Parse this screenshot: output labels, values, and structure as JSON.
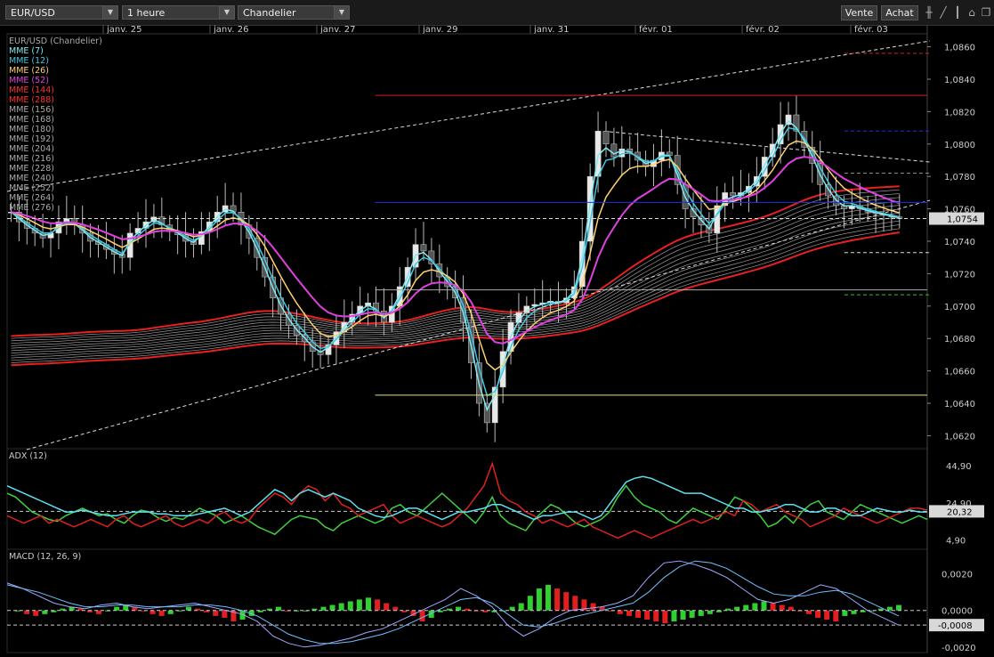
{
  "toolbar": {
    "instrument": "EUR/USD",
    "interval": "1 heure",
    "chart_style": "Chandelier",
    "sell_label": "Vente",
    "buy_label": "Achat",
    "icons": [
      "bar-chart-icon",
      "draw-line-icon",
      "candlestick-icon",
      "home-icon",
      "window-icon"
    ]
  },
  "colors": {
    "background": "#000000",
    "up": "#ffffff",
    "ema7": "#80e8f0",
    "ema12": "#40c8e0",
    "ema26": "#ffd070",
    "ema52": "#e040e0",
    "ema144": "#e82020",
    "ema288": "#d01010",
    "ribbon": "#9a9a9a",
    "adx_plus": "#40d040",
    "adx_minus": "#e02020",
    "adx": "#60e0f0",
    "macd_line": "#a0a8ff",
    "macd_signal": "#70c0ff"
  },
  "chart_data": [
    {
      "type": "candlestick",
      "title": "EUR/USD (Chandelier)",
      "x_ticks": [
        "janv. 25",
        "janv. 26",
        "janv. 27",
        "janv. 29",
        "janv. 31",
        "févr. 01",
        "févr. 02",
        "févr. 03"
      ],
      "y_ticks": [
        "1,0860",
        "1,0840",
        "1,0820",
        "1,0800",
        "1,0780",
        "1,0760",
        "1,0740",
        "1,0720",
        "1,0700",
        "1,0680",
        "1,0660",
        "1,0640",
        "1,0620"
      ],
      "ylim": [
        1.0612,
        1.0868
      ],
      "last_price": "1,0754",
      "legend": [
        "MME (7)",
        "MME (12)",
        "MME (26)",
        "MME (52)",
        "MME (144)",
        "MME (288)",
        "MME (156)",
        "MME (168)",
        "MME (180)",
        "MME (192)",
        "MME (204)",
        "MME (216)",
        "MME (228)",
        "MME (240)",
        "MME (252)",
        "MME (264)",
        "MME (276)"
      ],
      "legend_colors": [
        "#80e8f0",
        "#40c8e0",
        "#ffd070",
        "#e040e0",
        "#ff3030",
        "#ff3030",
        "#aaaaaa",
        "#aaaaaa",
        "#aaaaaa",
        "#aaaaaa",
        "#aaaaaa",
        "#aaaaaa",
        "#aaaaaa",
        "#aaaaaa",
        "#aaaaaa",
        "#aaaaaa",
        "#aaaaaa"
      ],
      "close_path": [
        1.0758,
        1.0752,
        1.0748,
        1.0745,
        1.0742,
        1.0745,
        1.0752,
        1.0754,
        1.075,
        1.0745,
        1.074,
        1.0738,
        1.0735,
        1.0732,
        1.073,
        1.0745,
        1.0748,
        1.0752,
        1.0755,
        1.075,
        1.0746,
        1.0744,
        1.074,
        1.0738,
        1.0746,
        1.0752,
        1.0758,
        1.0762,
        1.0758,
        1.075,
        1.0742,
        1.073,
        1.0718,
        1.0705,
        1.0695,
        1.0688,
        1.0682,
        1.0678,
        1.0672,
        1.067,
        1.0676,
        1.0684,
        1.069,
        1.0695,
        1.07,
        1.0702,
        1.0697,
        1.069,
        1.07,
        1.0712,
        1.0724,
        1.0738,
        1.0734,
        1.0726,
        1.0718,
        1.0712,
        1.0705,
        1.069,
        1.0665,
        1.064,
        1.0628,
        1.065,
        1.0672,
        1.069,
        1.0696,
        1.07,
        1.0701,
        1.0702,
        1.0703,
        1.0702,
        1.0705,
        1.0712,
        1.074,
        1.078,
        1.0808,
        1.08,
        1.0792,
        1.0797,
        1.0795,
        1.079,
        1.0786,
        1.079,
        1.0795,
        1.0793,
        1.0775,
        1.076,
        1.0755,
        1.075,
        1.0745,
        1.0762,
        1.077,
        1.0768,
        1.077,
        1.0774,
        1.078,
        1.0792,
        1.08,
        1.0812,
        1.0818,
        1.0808,
        1.0798,
        1.0788,
        1.0775,
        1.0768,
        1.0762,
        1.076,
        1.0762,
        1.076,
        1.0758,
        1.0757,
        1.0756,
        1.0755,
        1.0754
      ],
      "hlines": [
        {
          "value": 1.083,
          "color": "#d02020",
          "start": 0.4,
          "style": "solid"
        },
        {
          "value": 1.0764,
          "color": "#2030e0",
          "start": 0.4,
          "style": "solid"
        },
        {
          "value": 1.071,
          "color": "#aaaaaa",
          "start": 0.4,
          "style": "solid"
        },
        {
          "value": 1.0645,
          "color": "#e8e070",
          "start": 0.4,
          "style": "solid"
        },
        {
          "value": 1.0754,
          "color": "#dddddd",
          "start": 0.0,
          "style": "dashed"
        },
        {
          "value": 1.0856,
          "color": "#d02020",
          "start": 0.91,
          "style": "dashed"
        },
        {
          "value": 1.0808,
          "color": "#2030e0",
          "start": 0.91,
          "style": "dashed"
        },
        {
          "value": 1.0782,
          "color": "#888888",
          "start": 0.91,
          "style": "dashed"
        },
        {
          "value": 1.0733,
          "color": "#dddddd",
          "start": 0.91,
          "style": "dashed"
        },
        {
          "value": 1.0707,
          "color": "#30c030",
          "start": 0.91,
          "style": "dashed"
        }
      ]
    },
    {
      "type": "line",
      "title": "ADX (12)",
      "y_ticks": [
        "44,90",
        "24,90",
        "4,90"
      ],
      "ylim": [
        0,
        52
      ],
      "last_value": "20,32",
      "series": [
        {
          "name": "",
          "values": [
            30,
            28,
            24,
            20,
            18,
            16,
            15,
            18,
            20,
            22,
            20,
            18,
            19,
            16,
            14,
            18,
            21,
            20,
            17,
            15,
            17,
            16,
            19,
            22,
            20,
            18,
            14,
            16,
            18,
            15,
            12,
            10,
            8,
            12,
            16,
            18,
            17,
            16,
            12,
            10,
            14,
            16,
            18,
            16,
            14,
            16,
            22,
            24,
            20,
            18,
            22,
            26,
            30,
            26,
            22,
            18,
            14,
            20,
            28,
            18,
            14,
            12,
            10,
            16,
            20,
            24,
            22,
            18,
            14,
            12,
            14,
            16,
            20,
            28,
            34,
            28,
            24,
            22,
            20,
            16,
            14,
            18,
            22,
            20,
            18,
            16,
            22,
            28,
            26,
            22,
            18,
            12,
            14,
            18,
            14,
            20,
            24,
            26,
            20,
            18,
            16,
            20,
            24,
            22,
            20,
            18,
            16,
            14,
            16,
            18,
            16
          ]
        },
        {
          "name": "",
          "values": [
            18,
            16,
            14,
            16,
            18,
            14,
            16,
            14,
            12,
            14,
            16,
            14,
            12,
            16,
            18,
            14,
            12,
            14,
            16,
            18,
            14,
            12,
            14,
            16,
            14,
            18,
            20,
            16,
            14,
            16,
            22,
            26,
            30,
            28,
            24,
            30,
            34,
            32,
            26,
            30,
            24,
            22,
            18,
            20,
            22,
            24,
            18,
            14,
            16,
            18,
            16,
            14,
            12,
            14,
            18,
            22,
            28,
            34,
            46,
            30,
            26,
            24,
            20,
            18,
            14,
            16,
            14,
            12,
            14,
            16,
            12,
            10,
            8,
            6,
            8,
            10,
            8,
            6,
            8,
            10,
            12,
            14,
            16,
            14,
            16,
            18,
            20,
            18,
            26,
            24,
            20,
            22,
            24,
            20,
            18,
            16,
            12,
            14,
            16,
            18,
            22,
            20,
            18,
            16,
            14,
            16,
            18,
            20,
            22,
            22,
            21
          ]
        },
        {
          "name": "",
          "values": [
            34,
            32,
            30,
            28,
            26,
            24,
            22,
            20,
            20,
            21,
            20,
            19,
            18,
            18,
            19,
            20,
            20,
            20,
            19,
            19,
            18,
            18,
            18,
            19,
            20,
            21,
            22,
            20,
            18,
            20,
            24,
            28,
            32,
            30,
            26,
            30,
            32,
            30,
            28,
            30,
            28,
            26,
            22,
            20,
            18,
            17,
            18,
            20,
            22,
            22,
            20,
            18,
            16,
            18,
            20,
            20,
            21,
            22,
            24,
            24,
            22,
            20,
            18,
            16,
            18,
            18,
            19,
            20,
            20,
            18,
            16,
            18,
            24,
            30,
            36,
            38,
            39,
            38,
            36,
            34,
            32,
            30,
            30,
            30,
            28,
            26,
            24,
            22,
            22,
            20,
            20,
            21,
            22,
            24,
            24,
            22,
            20,
            20,
            22,
            22,
            20,
            18,
            18,
            20,
            22,
            21,
            20,
            20,
            21,
            20,
            20
          ]
        }
      ]
    },
    {
      "type": "bar",
      "title": "MACD (12, 26, 9)",
      "y_ticks": [
        "0,0020",
        "0,0000",
        "-0,0020"
      ],
      "ylim": [
        -0.0023,
        0.0031
      ],
      "last_value": "-0,0008",
      "histogram": [
        0.0,
        -0.0002,
        -0.0003,
        -0.0002,
        -0.0001,
        0.0001,
        0.0002,
        0.0001,
        -0.0001,
        -0.0002,
        0.0,
        0.0002,
        0.0003,
        0.0002,
        0.0,
        -0.0002,
        -0.0003,
        -0.0002,
        0.0,
        0.0002,
        0.0001,
        -0.0001,
        -0.0003,
        -0.0004,
        -0.0006,
        -0.0005,
        -0.0003,
        -0.0001,
        0.0001,
        0.0002,
        0.0,
        0.0,
        0.0,
        0.0001,
        0.0002,
        0.0003,
        0.0004,
        0.0005,
        0.0006,
        0.0007,
        0.0006,
        0.0004,
        0.0002,
        -0.0001,
        -0.0003,
        -0.0006,
        -0.0004,
        -0.0001,
        0.0001,
        0.0002,
        0.0001,
        0.0,
        -0.0001,
        -0.0001,
        0.0,
        0.0002,
        0.0004,
        0.0008,
        0.0012,
        0.0014,
        0.0012,
        0.001,
        0.0008,
        0.0006,
        0.0004,
        0.0002,
        0.0,
        -0.0002,
        -0.0003,
        -0.0004,
        -0.0005,
        -0.0006,
        -0.0007,
        -0.0006,
        -0.0005,
        -0.0004,
        -0.0003,
        -0.0002,
        -0.0001,
        0.0001,
        0.0002,
        0.0003,
        0.0004,
        0.0005,
        0.0004,
        0.0003,
        0.0002,
        0.0,
        -0.0002,
        -0.0004,
        -0.0005,
        -0.0006,
        -0.0003,
        -0.0002,
        -0.0001,
        0.0,
        0.0001,
        0.0002,
        0.0003
      ],
      "series": [
        {
          "name": "",
          "values": [
            0.0015,
            0.0012,
            0.0008,
            0.0004,
            0.0002,
            0.0001,
            0.0003,
            0.0004,
            0.0002,
            0.0001,
            0.0002,
            0.0003,
            0.0004,
            0.0002,
            0.0,
            -0.0002,
            -0.0006,
            -0.0014,
            -0.0018,
            -0.002,
            -0.0019,
            -0.0017,
            -0.0015,
            -0.0012,
            -0.001,
            -0.0006,
            -0.0002,
            0.0002,
            0.0006,
            0.0012,
            0.0008,
            0.0002,
            -0.0008,
            -0.0014,
            -0.001,
            -0.0004,
            0.0,
            0.0001,
            0.0002,
            0.0004,
            0.0008,
            0.0018,
            0.0026,
            0.0027,
            0.0025,
            0.0022,
            0.0018,
            0.0012,
            0.0006,
            0.0004,
            0.0006,
            0.001,
            0.0014,
            0.0012,
            0.0006,
            0.0,
            -0.0004,
            -0.0008
          ]
        },
        {
          "name": "",
          "values": [
            0.0014,
            0.0012,
            0.001,
            0.0007,
            0.0004,
            0.0002,
            0.0002,
            0.0003,
            0.0003,
            0.0002,
            0.0002,
            0.0002,
            0.0003,
            0.0003,
            0.0002,
            0.0,
            -0.0003,
            -0.0008,
            -0.0013,
            -0.0016,
            -0.0018,
            -0.0018,
            -0.0017,
            -0.0015,
            -0.0013,
            -0.001,
            -0.0006,
            -0.0002,
            0.0002,
            0.0006,
            0.0007,
            0.0004,
            -0.0002,
            -0.0008,
            -0.0009,
            -0.0007,
            -0.0004,
            -0.0002,
            0.0,
            0.0002,
            0.0004,
            0.001,
            0.0018,
            0.0024,
            0.0027,
            0.0026,
            0.0023,
            0.0018,
            0.0013,
            0.0009,
            0.0008,
            0.0008,
            0.001,
            0.0011,
            0.0009,
            0.0005,
            0.0001,
            -0.0003
          ]
        }
      ]
    }
  ]
}
